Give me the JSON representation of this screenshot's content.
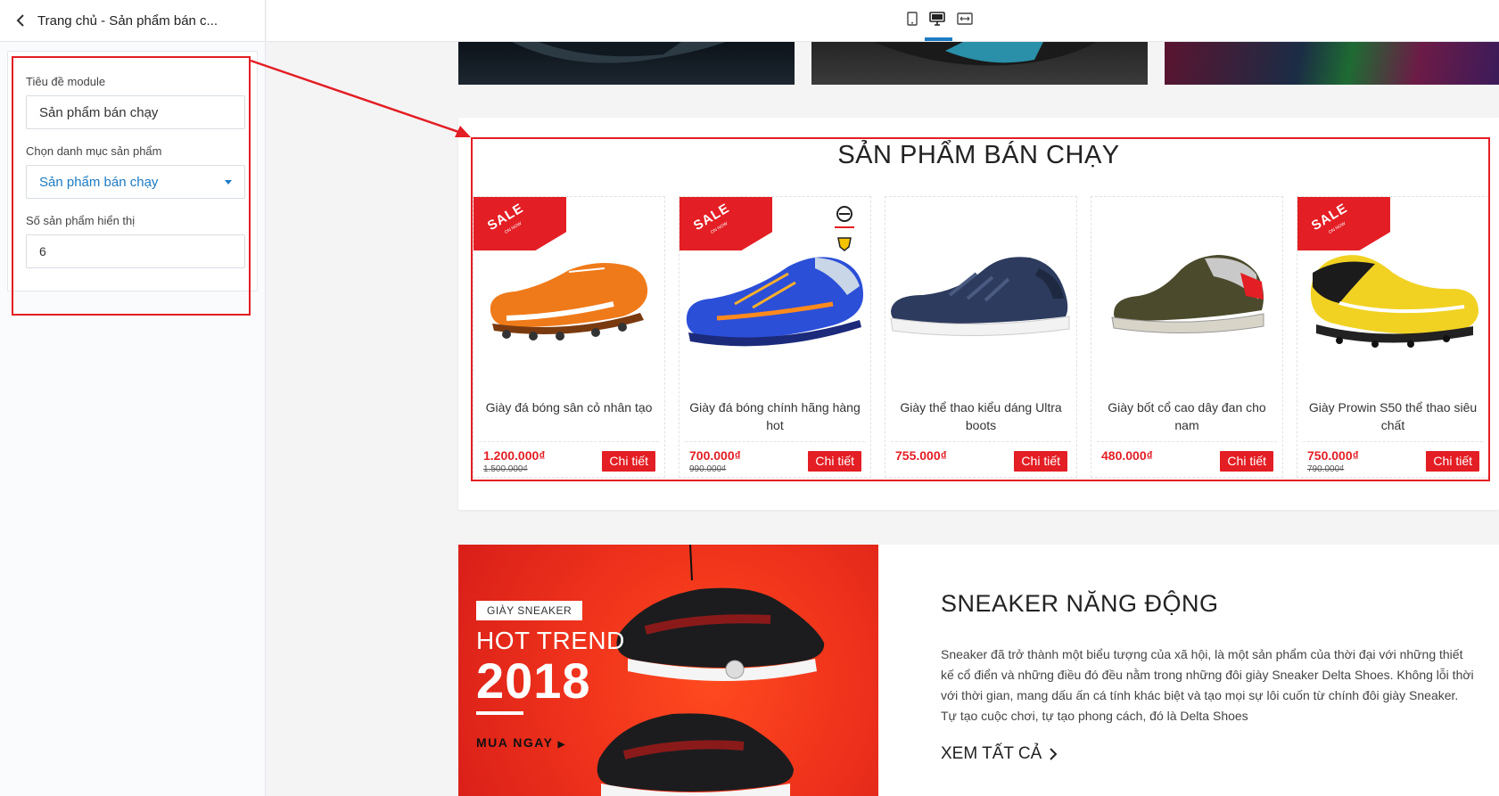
{
  "sidebar": {
    "header_title": "Trang chủ - Sản phẩm bán c...",
    "fields": {
      "module_title": {
        "label": "Tiêu đề module",
        "value": "Sản phẩm bán chạy"
      },
      "category": {
        "label": "Chọn danh mục sản phẩm",
        "value": "Sản phẩm bán chạy"
      },
      "count": {
        "label": "Số sản phẩm hiển thị",
        "value": "6"
      }
    }
  },
  "toolbar": {
    "icons": [
      "mobile-icon",
      "desktop-icon",
      "fullwidth-icon"
    ],
    "active": "desktop-icon",
    "active_color": "#1d7bc4"
  },
  "bestseller": {
    "title": "SẢN PHẨM BÁN CHẠY",
    "sale_text": "SALE",
    "sale_sub": "ON NOW",
    "detail_label": "Chi tiết",
    "products": [
      {
        "name": "Giày đá bóng sân cỏ nhân tạo",
        "price": "1.200.000₫",
        "old_price": "1.500.000₫",
        "sale": true
      },
      {
        "name": "Giày đá bóng chính hãng hàng hot",
        "price": "700.000₫",
        "old_price": "990.000₫",
        "sale": true
      },
      {
        "name": "Giày thể thao kiểu dáng Ultra boots",
        "price": "755.000₫",
        "old_price": "",
        "sale": false
      },
      {
        "name": "Giày bốt cổ cao dây đan cho nam",
        "price": "480.000₫",
        "old_price": "",
        "sale": false
      },
      {
        "name": "Giày Prowin S50 thể thao siêu chất",
        "price": "750.000₫",
        "old_price": "790.000₫",
        "sale": true
      }
    ]
  },
  "promo": {
    "tag": "GIÀY SNEAKER",
    "hot": "HOT TREND",
    "year": "2018",
    "buy": "MUA NGAY",
    "title": "SNEAKER NĂNG ĐỘNG",
    "description": "Sneaker đã trở thành một biểu tượng của xã hội, là một sản phẩm của thời đại với những thiết kế cổ điển và những điều đó đều nằm trong những đôi giày Sneaker Delta Shoes. Không lỗi thời với thời gian, mang dấu ấn cá tính khác biệt và tạo mọi sự lôi cuốn từ chính đôi giày Sneaker. Tự tạo cuộc chơi, tự tạo phong cách, đó là Delta Shoes",
    "link": "XEM TẤT CẢ"
  },
  "colors": {
    "accent": "#e31e24",
    "link": "#1d7bc4"
  }
}
